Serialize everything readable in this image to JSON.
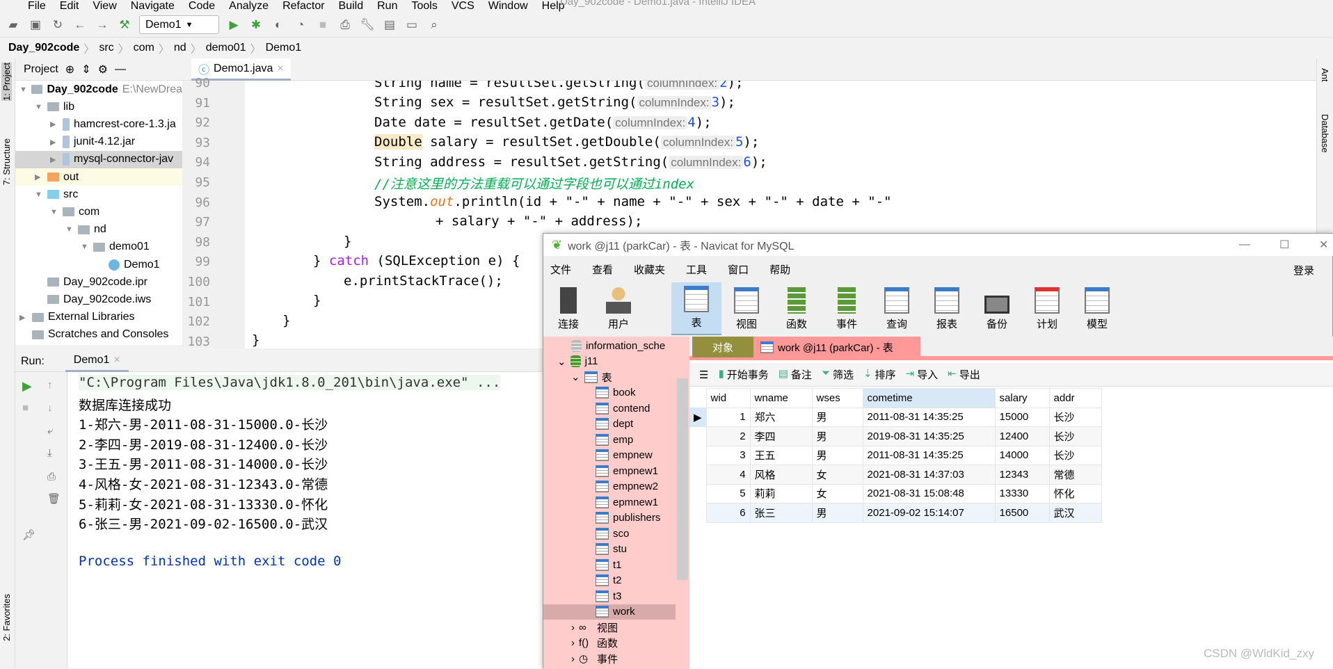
{
  "ide": {
    "menu": [
      "File",
      "Edit",
      "View",
      "Navigate",
      "Code",
      "Analyze",
      "Refactor",
      "Build",
      "Run",
      "Tools",
      "VCS",
      "Window",
      "Help"
    ],
    "window_title": "Day_902code - Demo1.java - IntelliJ IDEA",
    "run_config": "Demo1",
    "breadcrumb": [
      "Day_902code",
      "src",
      "com",
      "nd",
      "demo01",
      "Demo1"
    ],
    "left_tabs": [
      "1: Project",
      "7: Structure",
      "2: Favorites"
    ],
    "right_tabs": [
      "Ant",
      "Database"
    ],
    "project_label": "Project",
    "tree": [
      {
        "label": "Day_902code",
        "path": "E:\\NewDrea",
        "depth": 0,
        "expanded": true
      },
      {
        "label": "lib",
        "depth": 1,
        "expanded": true
      },
      {
        "label": "hamcrest-core-1.3.ja",
        "depth": 2
      },
      {
        "label": "junit-4.12.jar",
        "depth": 2
      },
      {
        "label": "mysql-connector-jav",
        "depth": 2,
        "selected": true
      },
      {
        "label": "out",
        "depth": 1
      },
      {
        "label": "src",
        "depth": 1,
        "expanded": true
      },
      {
        "label": "com",
        "depth": 2,
        "expanded": true
      },
      {
        "label": "nd",
        "depth": 3,
        "expanded": true
      },
      {
        "label": "demo01",
        "depth": 4,
        "expanded": true
      },
      {
        "label": "Demo1",
        "depth": 5
      },
      {
        "label": "Day_902code.ipr",
        "depth": 1
      },
      {
        "label": "Day_902code.iws",
        "depth": 1
      },
      {
        "label": "External Libraries",
        "depth": 0
      },
      {
        "label": "Scratches and Consoles",
        "depth": 0
      }
    ],
    "editor_tab": "Demo1.java",
    "line_numbers": [
      "90",
      "91",
      "92",
      "93",
      "94",
      "95",
      "96",
      "97",
      "98",
      "99",
      "100",
      "101",
      "102",
      "103"
    ],
    "code": {
      "l90a": "String name = resultSet.getString(",
      "l90h": "columnIndex:",
      "l90n": "2",
      "l90b": ");",
      "l91a": "String sex = resultSet.getString(",
      "l91h": "columnIndex:",
      "l91n": "3",
      "l91b": ");",
      "l92a": "Date date = resultSet.getDate(",
      "l92h": "columnIndex:",
      "l92n": "4",
      "l92b": ");",
      "l93k": "Double",
      "l93a": " salary = resultSet.getDouble(",
      "l93h": "columnIndex:",
      "l93n": "5",
      "l93b": ");",
      "l94a": "String address = resultSet.getString(",
      "l94h": "columnIndex:",
      "l94n": "6",
      "l94b": ");",
      "l95": "//注意这里的方法重载可以通过字段也可以通过index",
      "l96a": "System.",
      "l96o": "out",
      "l96b": ".println(id + \"-\" + name + \"-\" + sex + \"-\" + date + \"-\"",
      "l97": "+ salary + \"-\" + address);",
      "l98": "}",
      "l99a": "} ",
      "l99k": "catch",
      "l99b": " (SQLException e) {",
      "l100": "e.printStackTrace();",
      "l101": "}",
      "l102": "}",
      "l103": "}"
    },
    "run_label": "Run:",
    "run_tab": "Demo1",
    "console": [
      "\"C:\\Program Files\\Java\\jdk1.8.0_201\\bin\\java.exe\" ...",
      "数据库连接成功",
      "1-郑六-男-2011-08-31-15000.0-长沙",
      "2-李四-男-2019-08-31-12400.0-长沙",
      "3-王五-男-2011-08-31-14000.0-长沙",
      "4-风格-女-2021-08-31-12343.0-常德",
      "5-莉莉-女-2021-08-31-13330.0-怀化",
      "6-张三-男-2021-09-02-16500.0-武汉",
      "",
      "Process finished with exit code 0"
    ]
  },
  "navicat": {
    "title": "work @j11 (parkCar) - 表 - Navicat for MySQL",
    "menu": [
      "文件",
      "查看",
      "收藏夹",
      "工具",
      "窗口",
      "帮助"
    ],
    "login": "登录",
    "tools": [
      "连接",
      "用户",
      "表",
      "视图",
      "函数",
      "事件",
      "查询",
      "报表",
      "备份",
      "计划",
      "模型"
    ],
    "selected_tool": "表",
    "tree": {
      "info": "information_sche",
      "db": "j11",
      "tables_label": "表",
      "tables": [
        "book",
        "contend",
        "dept",
        "emp",
        "empnew",
        "empnew1",
        "empnew2",
        "epmnew1",
        "publishers",
        "sco",
        "stu",
        "t1",
        "t2",
        "t3",
        "work"
      ],
      "views": "视图",
      "funcs": "函数",
      "events": "事件"
    },
    "tabs": {
      "objects": "对象",
      "work": "work @j11 (parkCar) - 表"
    },
    "actions": [
      "开始事务",
      "备注",
      "筛选",
      "排序",
      "导入",
      "导出"
    ],
    "columns": [
      "wid",
      "wname",
      "wses",
      "cometime",
      "salary",
      "addr"
    ],
    "rows": [
      [
        "1",
        "郑六",
        "男",
        "2011-08-31 14:35:25",
        "15000",
        "长沙"
      ],
      [
        "2",
        "李四",
        "男",
        "2019-08-31 14:35:25",
        "12400",
        "长沙"
      ],
      [
        "3",
        "王五",
        "男",
        "2011-08-31 14:35:25",
        "14000",
        "长沙"
      ],
      [
        "4",
        "风格",
        "女",
        "2021-08-31 14:37:03",
        "12343",
        "常德"
      ],
      [
        "5",
        "莉莉",
        "女",
        "2021-08-31 15:08:48",
        "13330",
        "怀化"
      ],
      [
        "6",
        "张三",
        "男",
        "2021-09-02 15:14:07",
        "16500",
        "武汉"
      ]
    ],
    "tree_bg": "#ffcccc",
    "tab_accent": "#ff9999"
  },
  "watermark": "CSDN @WldKid_zxy"
}
